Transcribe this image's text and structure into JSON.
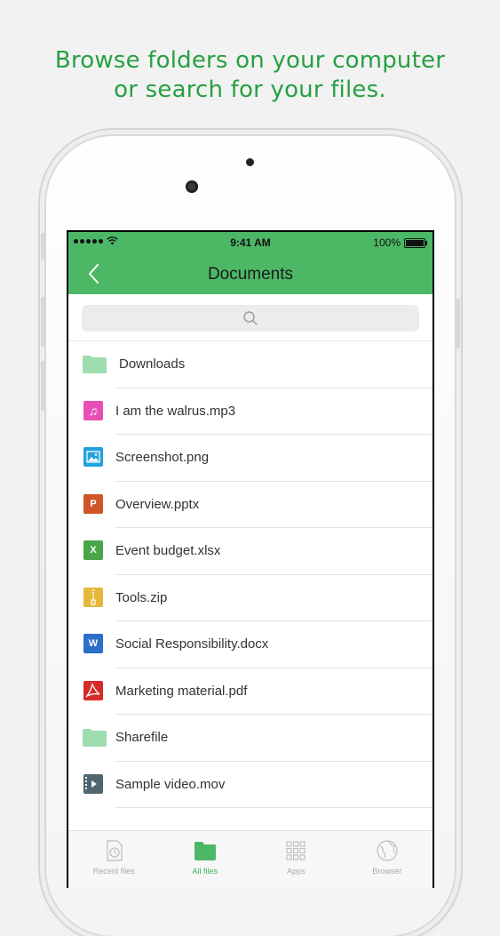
{
  "headline": {
    "line1": "Browse folders on your computer",
    "line2": "or search for your files."
  },
  "status_bar": {
    "time": "9:41 AM",
    "battery": "100%"
  },
  "nav": {
    "title": "Documents"
  },
  "colors": {
    "accent": "#4cb866",
    "headline": "#27a043"
  },
  "files": [
    {
      "name": "Downloads",
      "icon": "folder-icon",
      "color": "#9fdcaf"
    },
    {
      "name": "I am the walrus.mp3",
      "icon": "music-note-icon",
      "color": "#e84fb4",
      "glyph": "♫"
    },
    {
      "name": "Screenshot.png",
      "icon": "image-icon",
      "color": "#1fa3dd"
    },
    {
      "name": "Overview.pptx",
      "icon": "powerpoint-icon",
      "color": "#d0562a",
      "glyph": "P"
    },
    {
      "name": "Event budget.xlsx",
      "icon": "excel-icon",
      "color": "#4aa54a",
      "glyph": "X"
    },
    {
      "name": "Tools.zip",
      "icon": "zip-icon",
      "color": "#e5b83d"
    },
    {
      "name": "Social Responsibility.docx",
      "icon": "word-icon",
      "color": "#2c6fc9",
      "glyph": "W"
    },
    {
      "name": "Marketing material.pdf",
      "icon": "pdf-icon",
      "color": "#d62b2b"
    },
    {
      "name": "Sharefile",
      "icon": "folder-icon",
      "color": "#9fdcaf"
    },
    {
      "name": "Sample video.mov",
      "icon": "video-icon",
      "color": "#4f6670"
    }
  ],
  "tabs": [
    {
      "label": "Recent files",
      "icon": "clock-file-icon",
      "active": false
    },
    {
      "label": "All files",
      "icon": "folder-icon",
      "active": true
    },
    {
      "label": "Apps",
      "icon": "apps-grid-icon",
      "active": false
    },
    {
      "label": "Browser",
      "icon": "globe-icon",
      "active": false
    }
  ]
}
